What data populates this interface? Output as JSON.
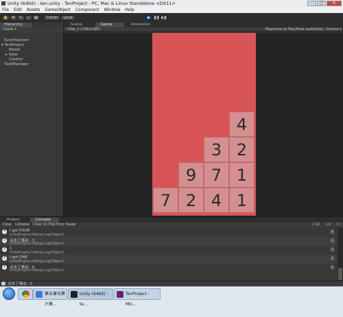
{
  "window": {
    "title": "Unity (64bit) - ten.unity - TenProject - PC, Mac & Linux Standalone <DX11>",
    "controls": [
      "–",
      "□",
      "✕"
    ]
  },
  "menu": [
    "File",
    "Edit",
    "Assets",
    "GameObject",
    "Component",
    "Window",
    "Help"
  ],
  "toolbar": {
    "pivot": "Center",
    "space": "Local",
    "play": "▶",
    "pause": "❚❚",
    "step": "▶❚"
  },
  "hierarchy": {
    "tab": "Hierarchy",
    "create": "Create ▾",
    "items": [
      "EventSystem",
      "TenProject",
      "Model",
      "View",
      "Control",
      "TaskManager"
    ]
  },
  "game": {
    "tabs": [
      "Scene",
      "Game",
      "Animation"
    ],
    "resolution": "720p_2 (720x1280)",
    "options": [
      "Maximize on Play",
      "Mute audio",
      "Stats",
      "Gizmos ▾"
    ],
    "board_color": "#d85557",
    "tile_color": "#d48f90",
    "tiles": [
      {
        "value": "4",
        "col": 3,
        "row": 3
      },
      {
        "value": "3",
        "col": 2,
        "row": 2
      },
      {
        "value": "2",
        "col": 3,
        "row": 2
      },
      {
        "value": "9",
        "col": 1,
        "row": 1
      },
      {
        "value": "7",
        "col": 2,
        "row": 1
      },
      {
        "value": "1",
        "col": 3,
        "row": 1
      },
      {
        "value": "7",
        "col": 0,
        "row": 0
      },
      {
        "value": "2",
        "col": 1,
        "row": 0
      },
      {
        "value": "4",
        "col": 2,
        "row": 0
      },
      {
        "value": "1",
        "col": 3,
        "row": 0
      }
    ]
  },
  "bottom": {
    "tabs": [
      "Project",
      "Console"
    ],
    "buttons": [
      "Clear",
      "Collapse",
      "Clear on Play",
      "Error Pause"
    ],
    "counts": {
      "info": "12",
      "warn": "0",
      "error": "0"
    },
    "logs": [
      {
        "msg": "I got FOUR",
        "sub": "UnityEngine.Debug:Log(Object)",
        "count": "1"
      },
      {
        "msg": "点击了滑动 : 3",
        "sub": "UnityEngine.Debug:Log(Object)",
        "count": "1"
      },
      {
        "msg": "1",
        "sub": "UnityEngine.Debug:Log(Object)",
        "count": "1"
      },
      {
        "msg": "I got ONE",
        "sub": "UnityEngine.Debug:Log(Object)",
        "count": "1"
      },
      {
        "msg": "点击了滑动 : 0",
        "sub": "UnityEngine.Debug:Log(Object)",
        "count": "1"
      }
    ]
  },
  "status": {
    "text": "点击了滑动 : 0"
  },
  "taskbar": {
    "items": [
      {
        "label": "第五章与第六章...",
        "color": "#3a7bd5"
      },
      {
        "label": "Unity (64bit) - te...",
        "color": "#222222"
      },
      {
        "label": "TenProject - Mic...",
        "color": "#68217a"
      }
    ]
  }
}
